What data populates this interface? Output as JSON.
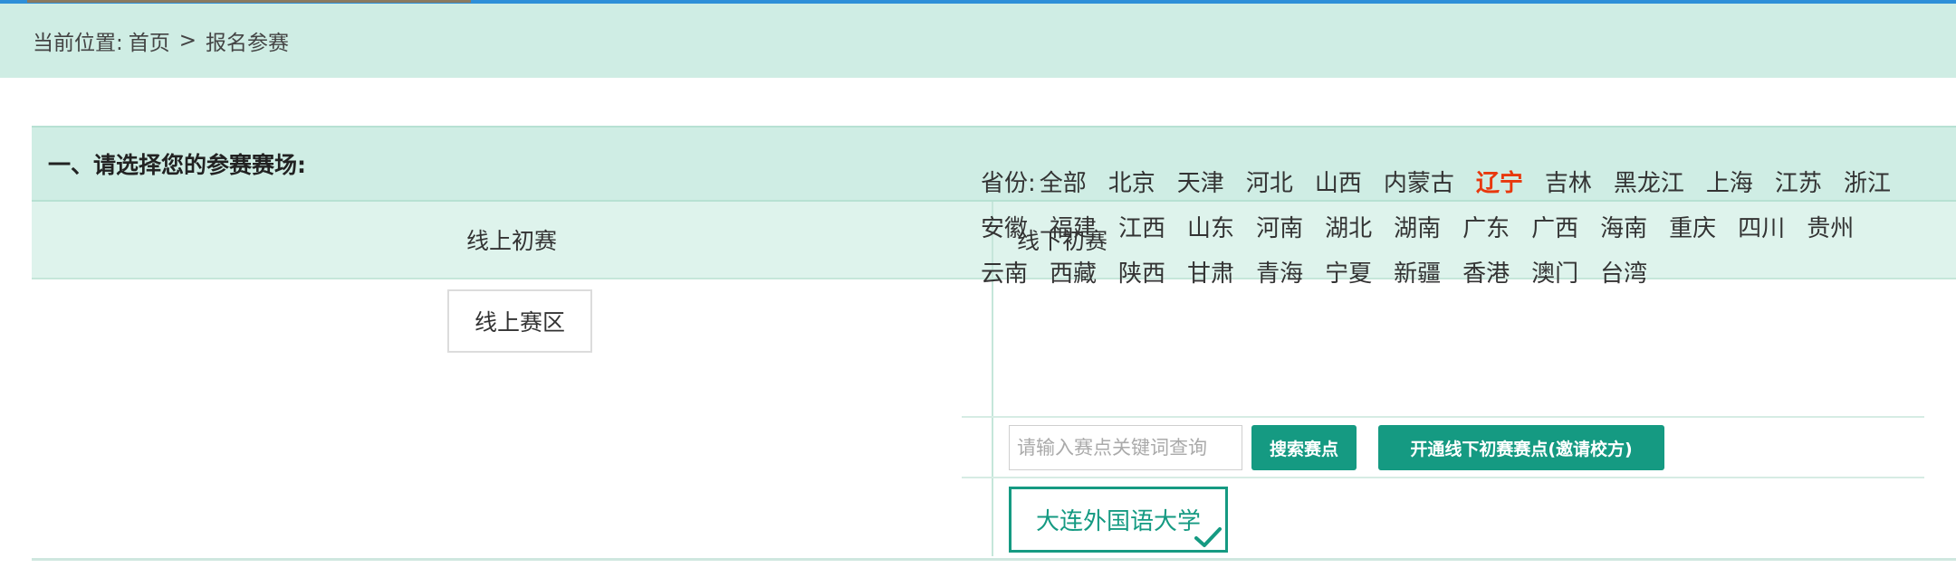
{
  "breadcrumb": {
    "prefix": "当前位置:",
    "home": "首页",
    "separator": ">",
    "current": "报名参赛"
  },
  "section": {
    "title": "一、请选择您的参赛赛场:"
  },
  "columns": {
    "online_head": "线上初赛",
    "offline_head": "线下初赛"
  },
  "online": {
    "area_button": "线上赛区"
  },
  "offline": {
    "province_label": "省份:",
    "provinces": [
      "全部",
      "北京",
      "天津",
      "河北",
      "山西",
      "内蒙古",
      "辽宁",
      "吉林",
      "黑龙江",
      "上海",
      "江苏",
      "浙江",
      "安徽",
      "福建",
      "江西",
      "山东",
      "河南",
      "湖北",
      "湖南",
      "广东",
      "广西",
      "海南",
      "重庆",
      "四川",
      "贵州",
      "云南",
      "西藏",
      "陕西",
      "甘肃",
      "青海",
      "宁夏",
      "新疆",
      "香港",
      "澳门",
      "台湾"
    ],
    "active_province": "辽宁",
    "search_placeholder": "请输入赛点关键词查询",
    "search_button": "搜索赛点",
    "open_button": "开通线下初赛赛点(邀请校方)",
    "selected_site": "大连外国语大学"
  },
  "colors": {
    "accent": "#159a82",
    "active_province": "#e8380d",
    "header_bg": "#cfede4"
  },
  "icons": {
    "selected_check": "checkmark-icon"
  }
}
